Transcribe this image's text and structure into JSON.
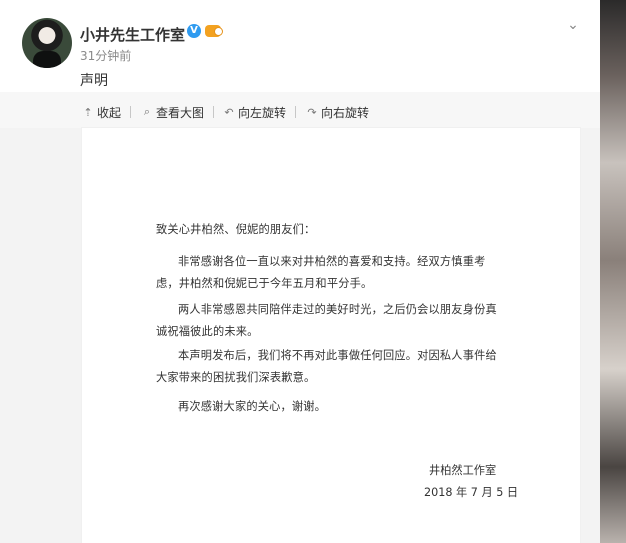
{
  "post": {
    "author": "小井先生工作室",
    "time": "31分钟前",
    "text": "声明"
  },
  "toolbar": {
    "collapse": "收起",
    "view_large": "查看大图",
    "rotate_left": "向左旋转",
    "rotate_right": "向右旋转"
  },
  "document": {
    "greeting": "致关心井柏然、倪妮的朋友们：",
    "paragraphs": [
      "非常感谢各位一直以来对井柏然的喜爱和支持。经双方慎重考虑，井柏然和倪妮已于今年五月和平分手。",
      "两人非常感恩共同陪伴走过的美好时光，之后仍会以朋友身份真诚祝福彼此的未来。",
      "本声明发布后，我们将不再对此事做任何回应。对因私人事件给大家带来的困扰我们深表歉意。",
      "再次感谢大家的关心，谢谢。"
    ],
    "signature": "井柏然工作室",
    "date": "2018 年 7 月 5 日"
  },
  "icons": {
    "verified": "verified-v-icon",
    "member": "member-badge-icon",
    "collapse": "arrow-up-icon",
    "view": "magnifier-icon",
    "rotate_left": "rotate-left-icon",
    "rotate_right": "rotate-right-icon",
    "more": "chevron-down-icon"
  },
  "colors": {
    "verified": "#2f9bf0",
    "badge": "#f3a221",
    "text": "#333333",
    "muted": "#8a8a8a"
  }
}
